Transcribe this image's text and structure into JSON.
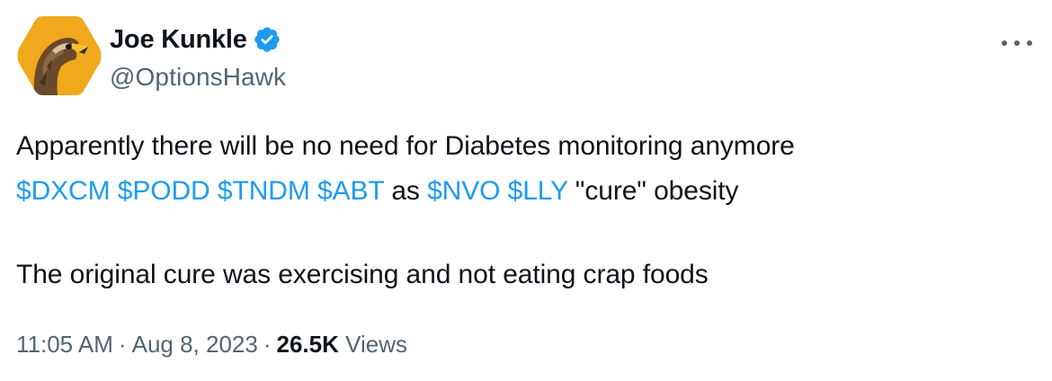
{
  "author": {
    "display_name": "Joe Kunkle",
    "handle": "@OptionsHawk",
    "verified": true,
    "avatar_icon": "hawk-avatar-icon"
  },
  "tweet": {
    "line1": "Apparently there will be no need for Diabetes monitoring anymore",
    "line2": {
      "cashtags_a": [
        "$DXCM",
        "$PODD",
        "$TNDM",
        "$ABT"
      ],
      "connector": "as",
      "cashtags_b": [
        "$NVO",
        "$LLY"
      ],
      "tail": "\"cure\" obesity"
    },
    "line3": "The original cure was exercising and not eating crap foods"
  },
  "meta": {
    "time": "11:05 AM",
    "separator": "·",
    "date": "Aug 8, 2023",
    "views_count": "26.5K",
    "views_label": "Views"
  },
  "colors": {
    "link": "#1d9bf0",
    "text": "#0f1419",
    "secondary": "#536471",
    "verified_badge": "#1d9bf0",
    "avatar_bg": "#f0a81c"
  }
}
